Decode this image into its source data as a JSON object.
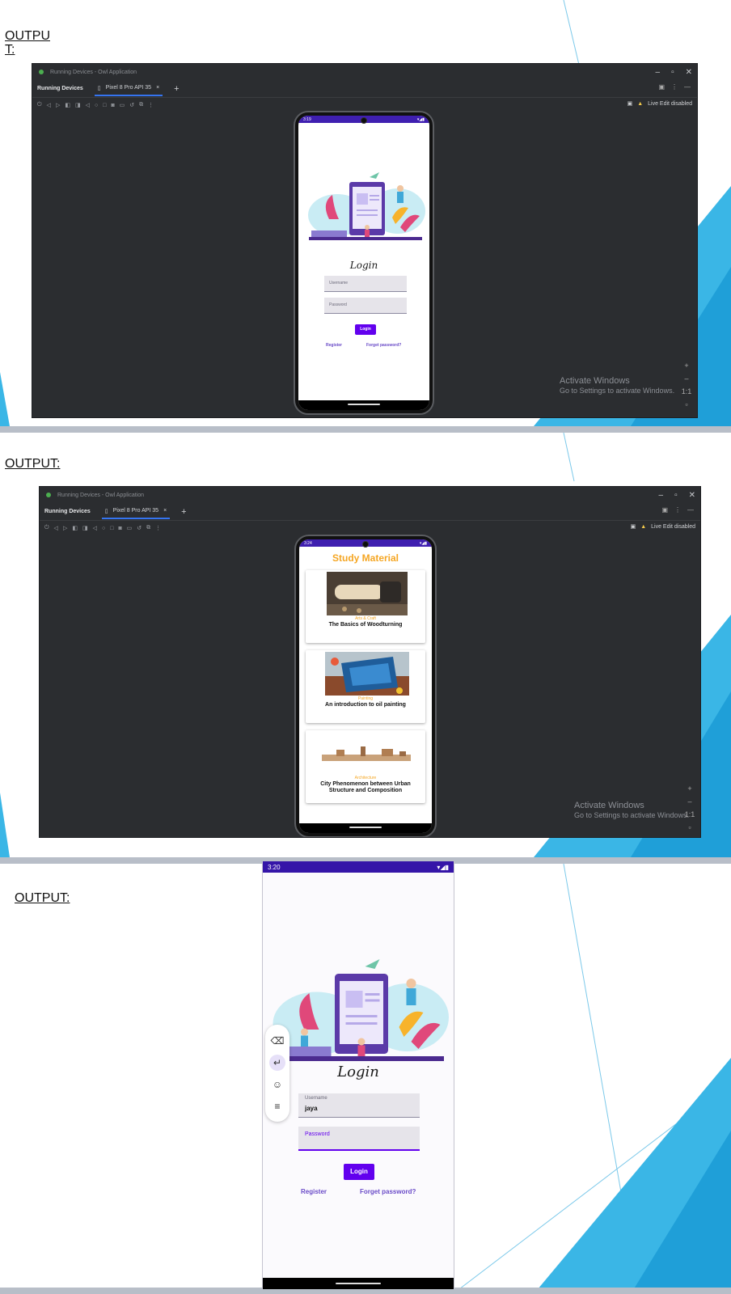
{
  "slides": [
    {
      "heading": "OUTPU\nT:"
    },
    {
      "heading": "OUTPUT:"
    },
    {
      "heading": "OUTPUT:"
    }
  ],
  "ide": {
    "window_title": "Running Devices - Owl Application",
    "tab_running": "Running Devices",
    "tab_device": "Pixel 8 Pro API 35",
    "tab_close": "×",
    "tab_add": "+",
    "live_edit": "Live Edit disabled",
    "activate_title": "Activate Windows",
    "activate_sub": "Go to Settings to activate Windows.",
    "zoom_plus": "+",
    "zoom_ratio": "1:1"
  },
  "phone1": {
    "time": "3:19",
    "login_title": "Login",
    "username_placeholder": "Username",
    "password_placeholder": "Password",
    "login_button": "Login",
    "register_link": "Register",
    "forget_link": "Forget password?"
  },
  "phone2": {
    "time": "3:24",
    "title": "Study Material",
    "cards": [
      {
        "category": "Arts & Craft",
        "title": "The Basics of Woodturning"
      },
      {
        "category": "Painting",
        "title": "An introduction to oil painting"
      },
      {
        "category": "Architecture",
        "title": "City Phenomenon between Urban Structure and Composition"
      }
    ]
  },
  "phone3": {
    "time": "3:20",
    "login_title": "Login",
    "username_label": "Username",
    "username_value": "jaya",
    "password_label": "Password",
    "login_button": "Login",
    "register_link": "Register",
    "forget_link": "Forget password?"
  },
  "colors": {
    "accent": "#6200ee",
    "status_bar": "#3f1fb0",
    "study_title": "#f5a623",
    "ide_bg": "#2b2d30",
    "deco_blue": "#3ab6e6"
  }
}
